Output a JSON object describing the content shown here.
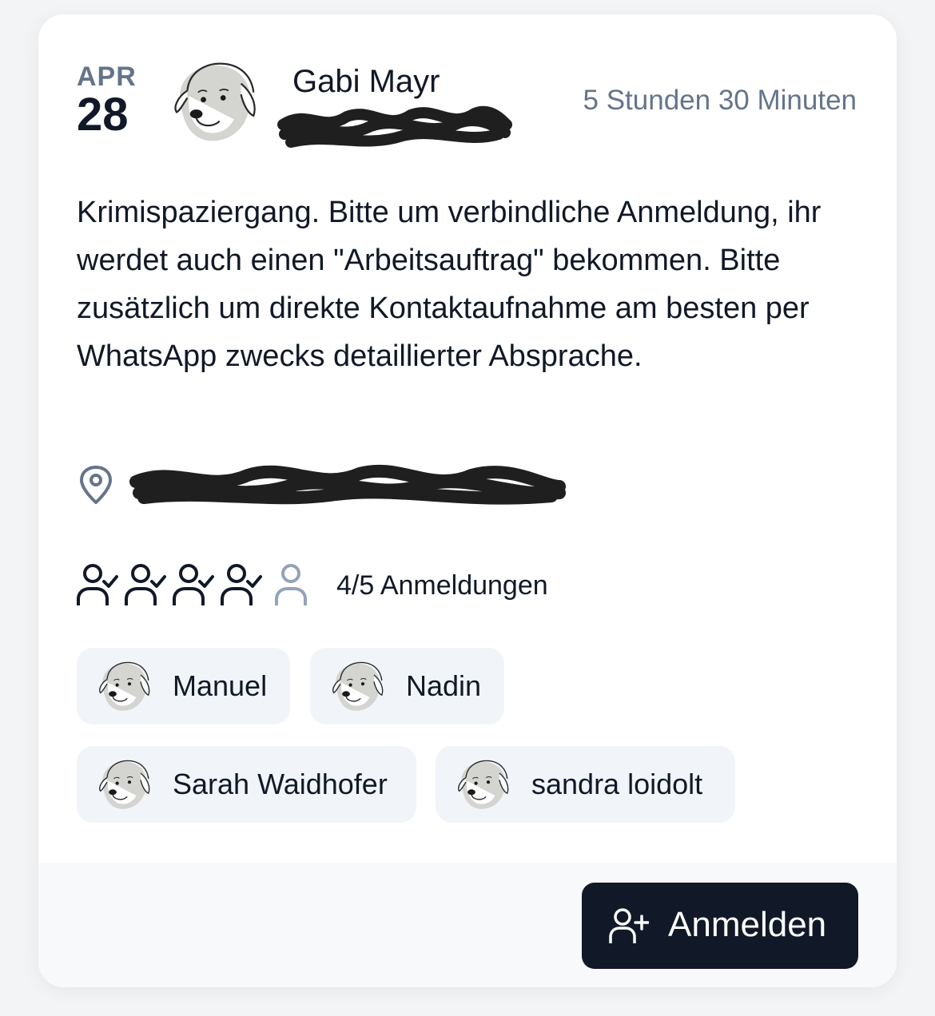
{
  "event": {
    "date": {
      "month": "APR",
      "day": "28"
    },
    "host": {
      "name": "Gabi Mayr",
      "avatar": "dog-avatar"
    },
    "duration": "5 Stunden 30 Minuten",
    "description": "Krimispaziergang. Bitte um verbindliche Anmeldung, ihr werdet auch einen \"Arbeitsauftrag\" bekommen. Bitte zusätzlich um direkte Kontaktaufnahme am besten per WhatsApp zwecks detaillierter Absprache.",
    "location_icon": "map-pin-icon",
    "attendance": {
      "text": "4/5 Anmeldungen",
      "registered": 4,
      "capacity": 5
    },
    "participants": [
      {
        "name": "Manuel"
      },
      {
        "name": "Nadin"
      },
      {
        "name": "Sarah Waidhofer"
      },
      {
        "name": "sandra loidolt"
      }
    ],
    "register_button": {
      "label": "Anmelden",
      "icon": "user-plus-icon"
    }
  },
  "colors": {
    "text": "#111827",
    "muted": "#64748b",
    "chip_bg": "#f1f5f9",
    "button_bg": "#111827",
    "avatar_fill": "#d4d4d0"
  }
}
